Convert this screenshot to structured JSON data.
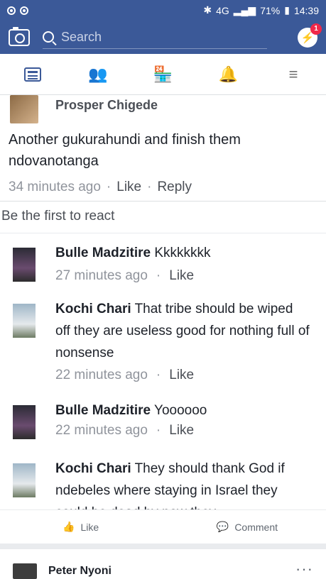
{
  "status_bar": {
    "network": "4G",
    "battery": "71%",
    "time": "14:39"
  },
  "topbar": {
    "search_placeholder": "Search",
    "messenger_badge": "1"
  },
  "nav": {
    "items": [
      "news-feed",
      "friends",
      "marketplace",
      "notifications",
      "menu"
    ]
  },
  "comment": {
    "author": "Prosper Chigede",
    "text": "Another gukurahundi and finish them ndovanotanga",
    "time": "34 minutes ago",
    "separator": "·",
    "like": "Like",
    "reply": "Reply"
  },
  "react_text": "Be the first to react",
  "replies": [
    {
      "author": "Bulle Madzitire",
      "text": "Kkkkkkkk",
      "time": "27 minutes ago",
      "like": "Like"
    },
    {
      "author": "Kochi Chari",
      "text": "That tribe should be wiped off they are useless good for nothing full of nonsense",
      "time": "22 minutes ago",
      "like": "Like"
    },
    {
      "author": "Bulle Madzitire",
      "text": "Yoooooo",
      "time": "22 minutes ago",
      "like": "Like"
    },
    {
      "author": "Kochi Chari",
      "text": "They should thank God if ndebeles where staying in Israel they could be dead by now they",
      "time": "",
      "like": ""
    }
  ],
  "actions": {
    "like_label": "Like",
    "comment_label": "Comment"
  },
  "next_post": {
    "author": "Peter Nyoni",
    "more": "···"
  }
}
